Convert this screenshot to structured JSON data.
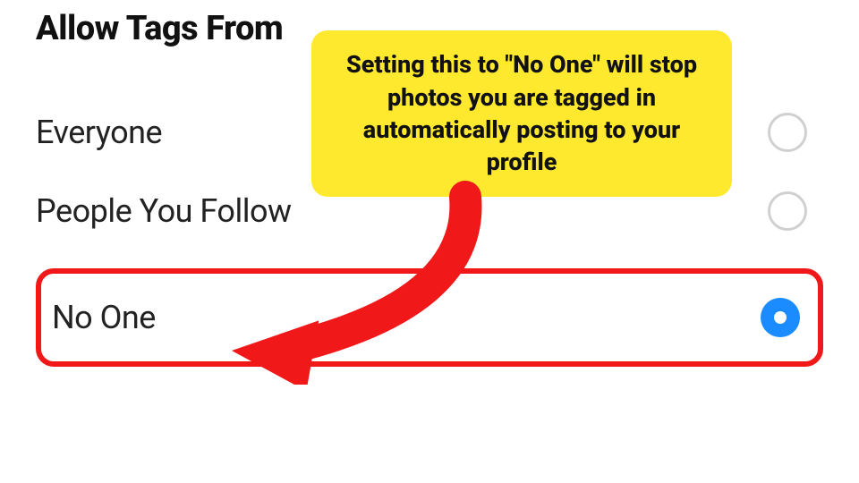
{
  "heading": "Allow Tags From",
  "options": [
    {
      "label": "Everyone",
      "selected": false
    },
    {
      "label": "People You Follow",
      "selected": false
    },
    {
      "label": "No One",
      "selected": true
    }
  ],
  "callout_text": "Setting this to \"No One\" will stop photos you are tagged in automatically posting to your profile",
  "colors": {
    "highlight_border": "#f01818",
    "callout_bg": "#ffe92e",
    "radio_selected": "#1a8cff"
  }
}
